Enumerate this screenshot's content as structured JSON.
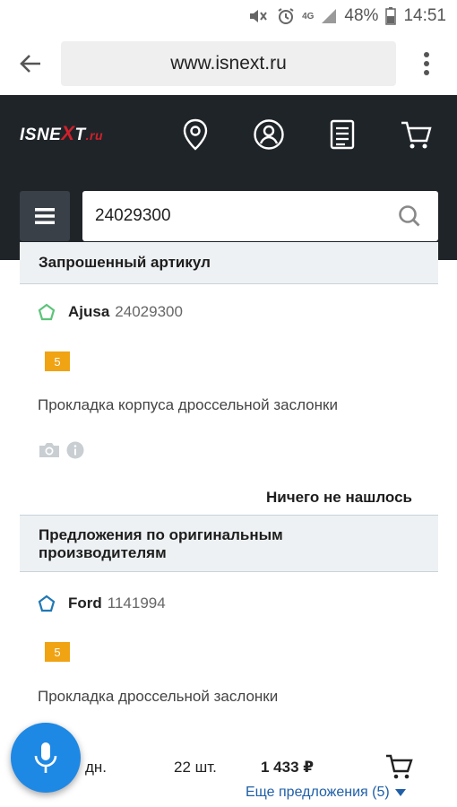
{
  "status_bar": {
    "battery": "48%",
    "time": "14:51",
    "network": "4G"
  },
  "browser": {
    "url": "www.isnext.ru"
  },
  "header": {
    "logo_part1": "ISNE",
    "logo_x": "X",
    "logo_part2": "T",
    "logo_domain": ".ru"
  },
  "search": {
    "value": "24029300"
  },
  "requested": {
    "heading": "Запрошенный артикул",
    "brand": "Ajusa",
    "sku": "24029300",
    "badge": "5",
    "description": "Прокладка корпуса дроссельной заслонки",
    "nothing_found": "Ничего не нашлось"
  },
  "original_offers": {
    "heading_line1": "Предложения по оригинальным",
    "heading_line2": "производителям",
    "brand": "Ford",
    "sku": "1141994",
    "badge": "5",
    "description": "Прокладка дроссельной заслонки",
    "delivery": "дн.",
    "quantity": "22 шт.",
    "price": "1 433 ₽",
    "more_offers": "Еще предложения (5)"
  },
  "colors": {
    "header_bg": "#1f2429",
    "badge": "#f0a313",
    "link": "#1f5fa8",
    "mic": "#1e88e5",
    "pentagon_green": "#5cc47a",
    "pentagon_blue": "#1f78b4"
  }
}
